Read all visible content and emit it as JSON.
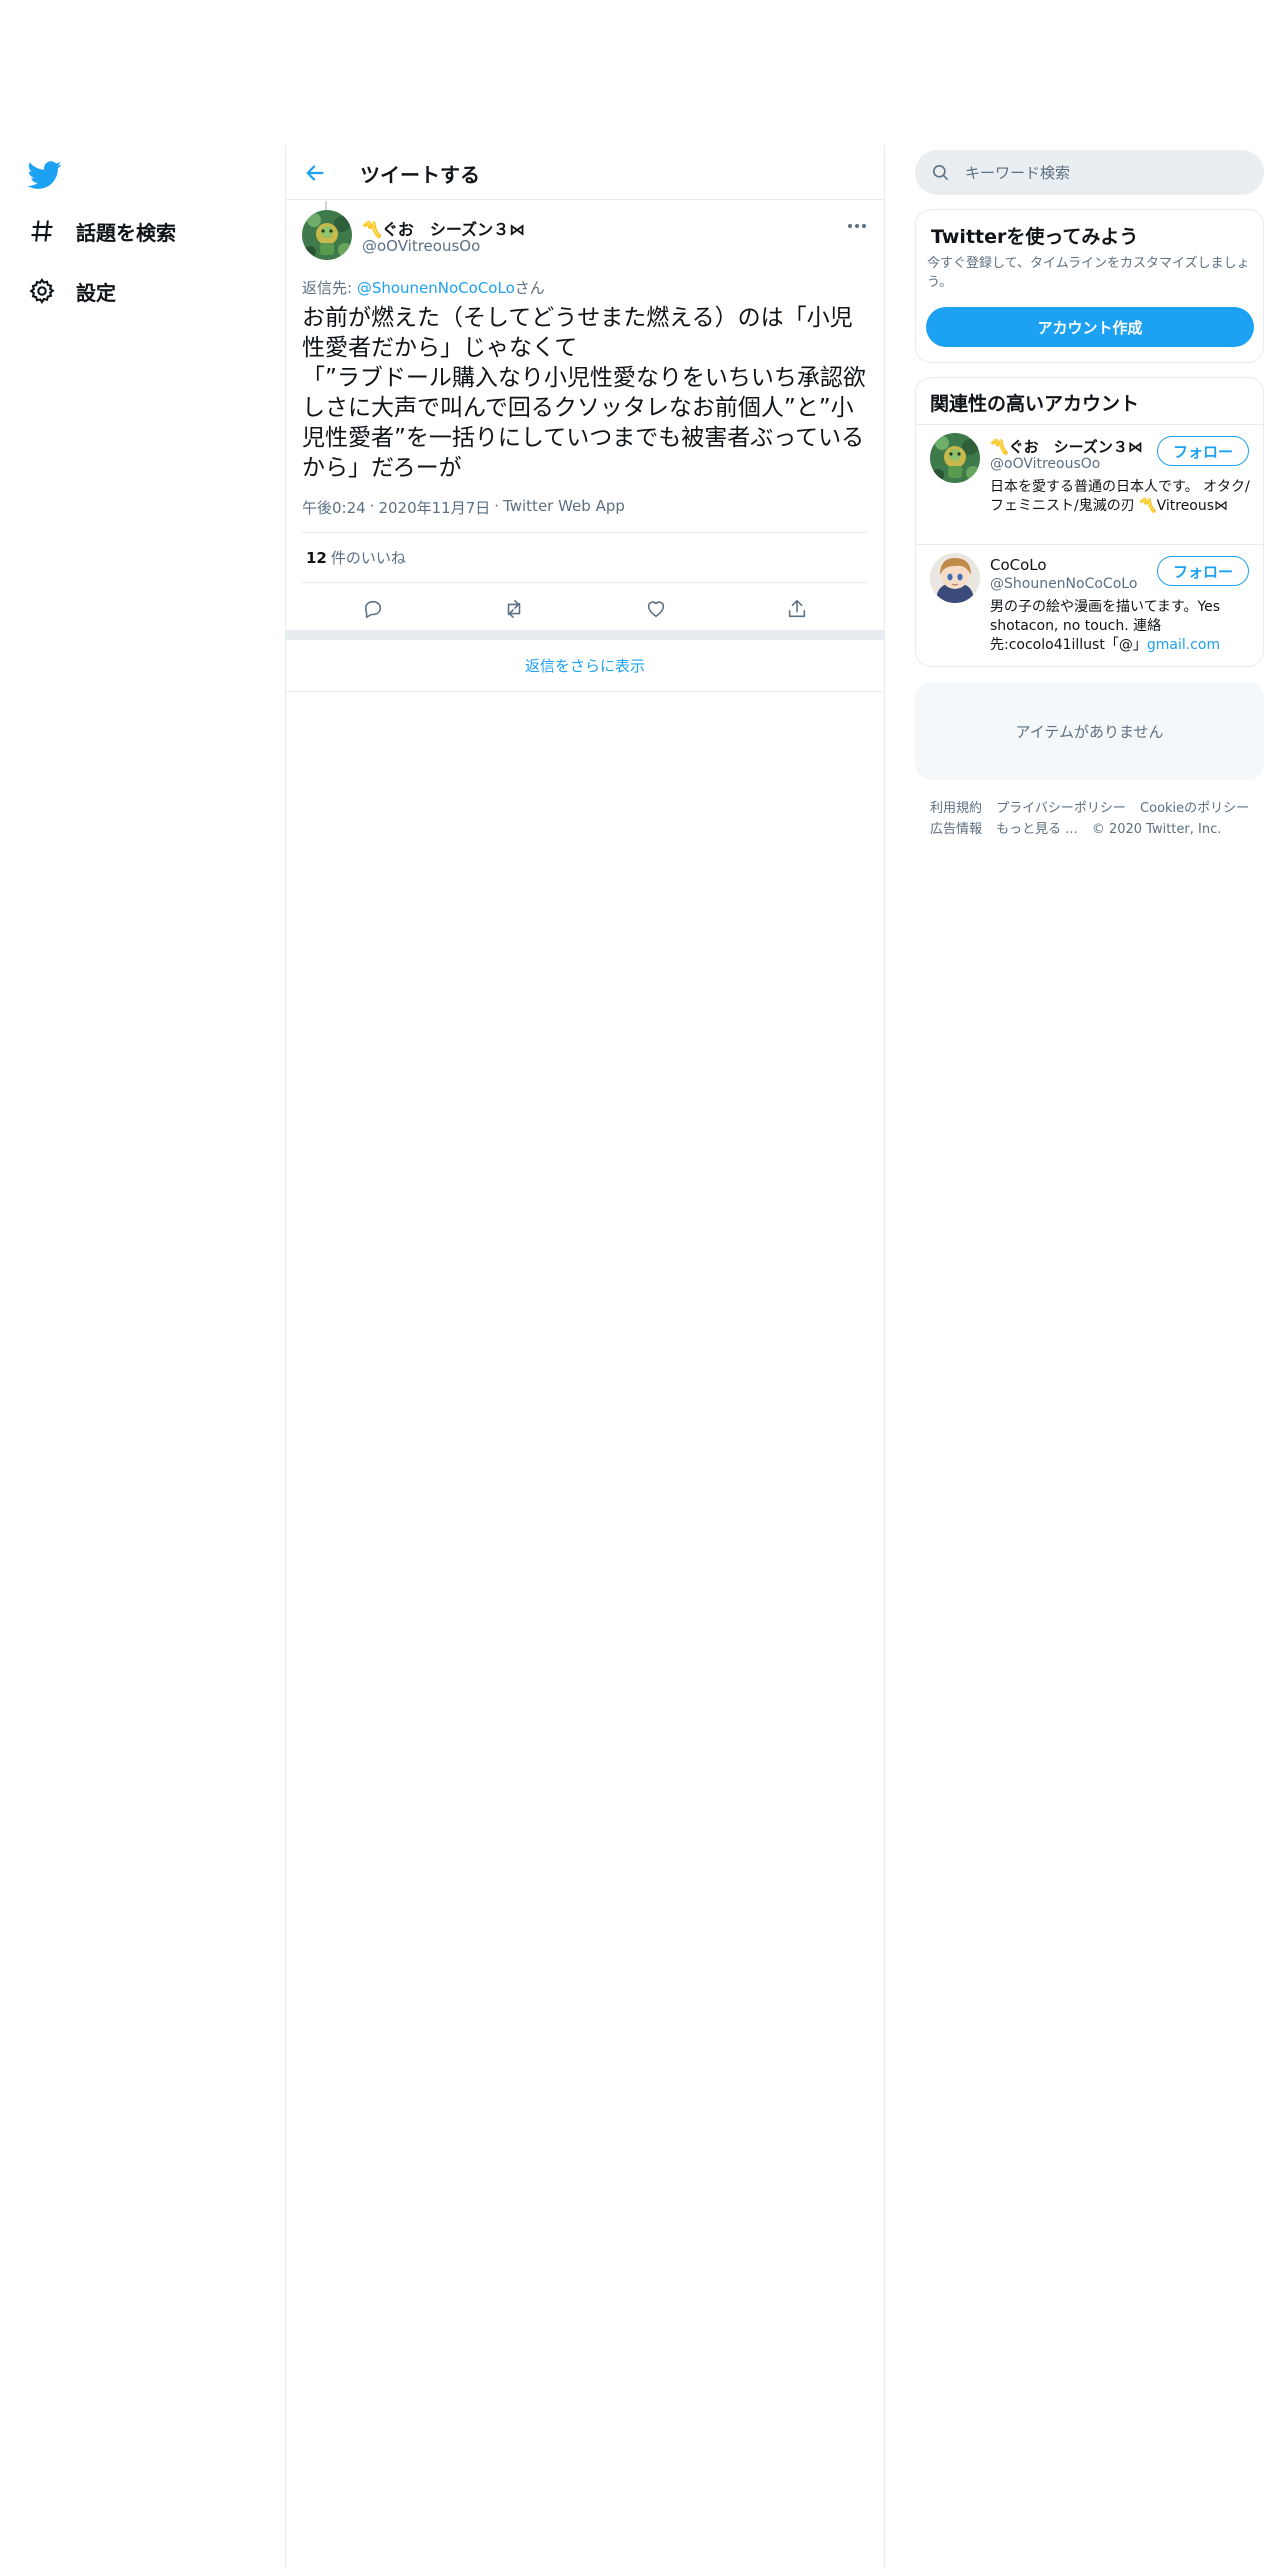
{
  "nav": {
    "items": [
      {
        "label": "話題を検索",
        "icon": "hashtag-icon"
      },
      {
        "label": "設定",
        "icon": "gear-icon"
      }
    ]
  },
  "header": {
    "title": "ツイートする"
  },
  "tweet": {
    "author_name": "〽️ぐお　シーズン３⋈",
    "author_handle": "@oOVitreousOo",
    "reply_prefix": "返信先: ",
    "reply_mention": "@ShounenNoCoCoLo",
    "reply_suffix": "さん",
    "text": "お前が燃えた（そしてどうせまた燃える）のは「小児性愛者だから」じゃなくて\n「”ラブドール購入なり小児性愛なりをいちいち承認欲しさに大声で叫んで回るクソッタレなお前個人”と”小児性愛者”を一括りにしていつまでも被害者ぶっているから」だろーが",
    "time": "午後0:24",
    "date": "2020年11月7日",
    "source": "Twitter Web App",
    "meta_sep": "·",
    "likes_count": "12",
    "likes_label": "件のいいね",
    "show_more_replies": "返信をさらに表示"
  },
  "search": {
    "placeholder": "キーワード検索"
  },
  "signup": {
    "title": "Twitterを使ってみよう",
    "description": "今すぐ登録して、タイムラインをカスタマイズしましょう。",
    "button": "アカウント作成"
  },
  "related": {
    "title": "関連性の高いアカウント",
    "follow_label": "フォロー",
    "accounts": [
      {
        "name": "〽️ぐお　シーズン３⋈",
        "handle": "@oOVitreousOo",
        "bio": "日本を愛する普通の日本人です。 オタク/フェミニスト/鬼滅の刃 〽️Vitreous⋈"
      },
      {
        "name": "CoCoLo",
        "handle": "@ShounenNoCoCoLo",
        "bio_text": "男の子の絵や漫画を描いてます。Yes shotacon, no touch. 連絡先:cocolo41illust「@」",
        "bio_link": "gmail.com"
      }
    ]
  },
  "empty": {
    "text": "アイテムがありません"
  },
  "footer": {
    "links": [
      "利用規約",
      "プライバシーポリシー",
      "Cookieのポリシー",
      "広告情報",
      "もっと見る ..."
    ],
    "copyright": "© 2020 Twitter, Inc."
  },
  "colors": {
    "accent": "#1da1f2",
    "secondary_text": "#5b7083",
    "border": "#e6ecf0"
  }
}
